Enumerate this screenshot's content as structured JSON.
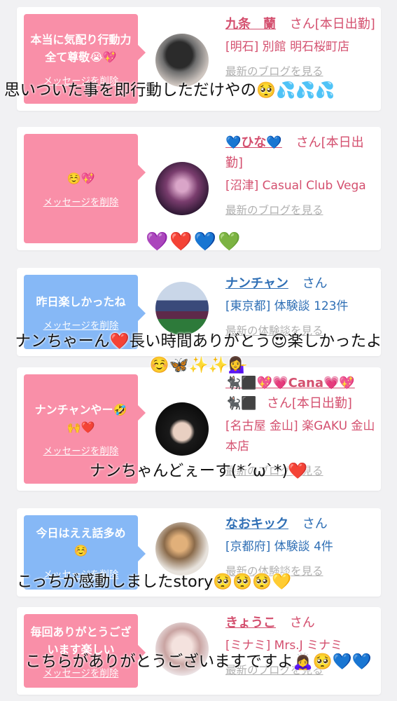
{
  "cards": [
    {
      "bubble_color": "#f98fa8",
      "message": "本当に気配り行動力全て尊敬😭💖",
      "delete_label": "メッセージを削除",
      "name": "九条　蘭",
      "honorific": "さん",
      "suffix": "[本日出勤]",
      "location": "[明石] 別館 明石桜町店",
      "blog_link": "最新のブログを見る",
      "overlay": "思いついた事を即行動しただけやの🥺💦💦💦"
    },
    {
      "bubble_color": "#f98fa8",
      "message": "☺️💖",
      "delete_label": "メッセージを削除",
      "name": "💙ひな💙",
      "honorific": "さん",
      "suffix": "[本日出勤]",
      "location": "[沼津] Casual Club Vega",
      "blog_link": "最新のブログを見る",
      "overlay": "💜❤️💙💚"
    },
    {
      "bubble_color": "#86b8f6",
      "message": "昨日楽しかったね",
      "delete_label": "メッセージを削除",
      "name": "ナンチャン",
      "honorific": "さん",
      "suffix": "",
      "location": "[東京都] 体験談 123件",
      "blog_link": "最新の体験談を見る",
      "overlay": "ナンちゃーん❤️長い時間ありがとう😍楽しかったよ☺️🦋✨✨💁‍♀️"
    },
    {
      "bubble_color": "#f98fa8",
      "message": "ナンチャンやー🤣🙌❤️",
      "delete_label": "メッセージを削除",
      "name": "🐈‍⬛⬛💖💗Cana💗💖",
      "honorific": "さん",
      "suffix": "[本日出勤]",
      "name_prefix": "🐈‍⬛⬛",
      "location": "[名古屋 金山] 楽GAKU 金山本店",
      "blog_link": "最新のブログを見る",
      "overlay": "ナンちゃんどぇーす(*´ω`*)❤️"
    },
    {
      "bubble_color": "#86b8f6",
      "message": "今日はええ話多め☺️",
      "delete_label": "メッセージを削除",
      "name": "なおキック",
      "honorific": "さん",
      "suffix": "",
      "location": "[京都府] 体験談 4件",
      "blog_link": "最新の体験談を見る",
      "overlay": "こっちが感動しましたstory🥺🥺🥺💛"
    },
    {
      "bubble_color": "#f98fa8",
      "message": "毎回ありがとうございます楽しい",
      "delete_label": "メッセージを削除",
      "name": "きょうこ",
      "honorific": "さん",
      "suffix": "",
      "location": "[ミナミ] Mrs.J ミナミ",
      "blog_link": "最新のブログを見る",
      "overlay": "こちらがありがとうございますですよ🙇‍♀️🥺💙💙"
    }
  ]
}
